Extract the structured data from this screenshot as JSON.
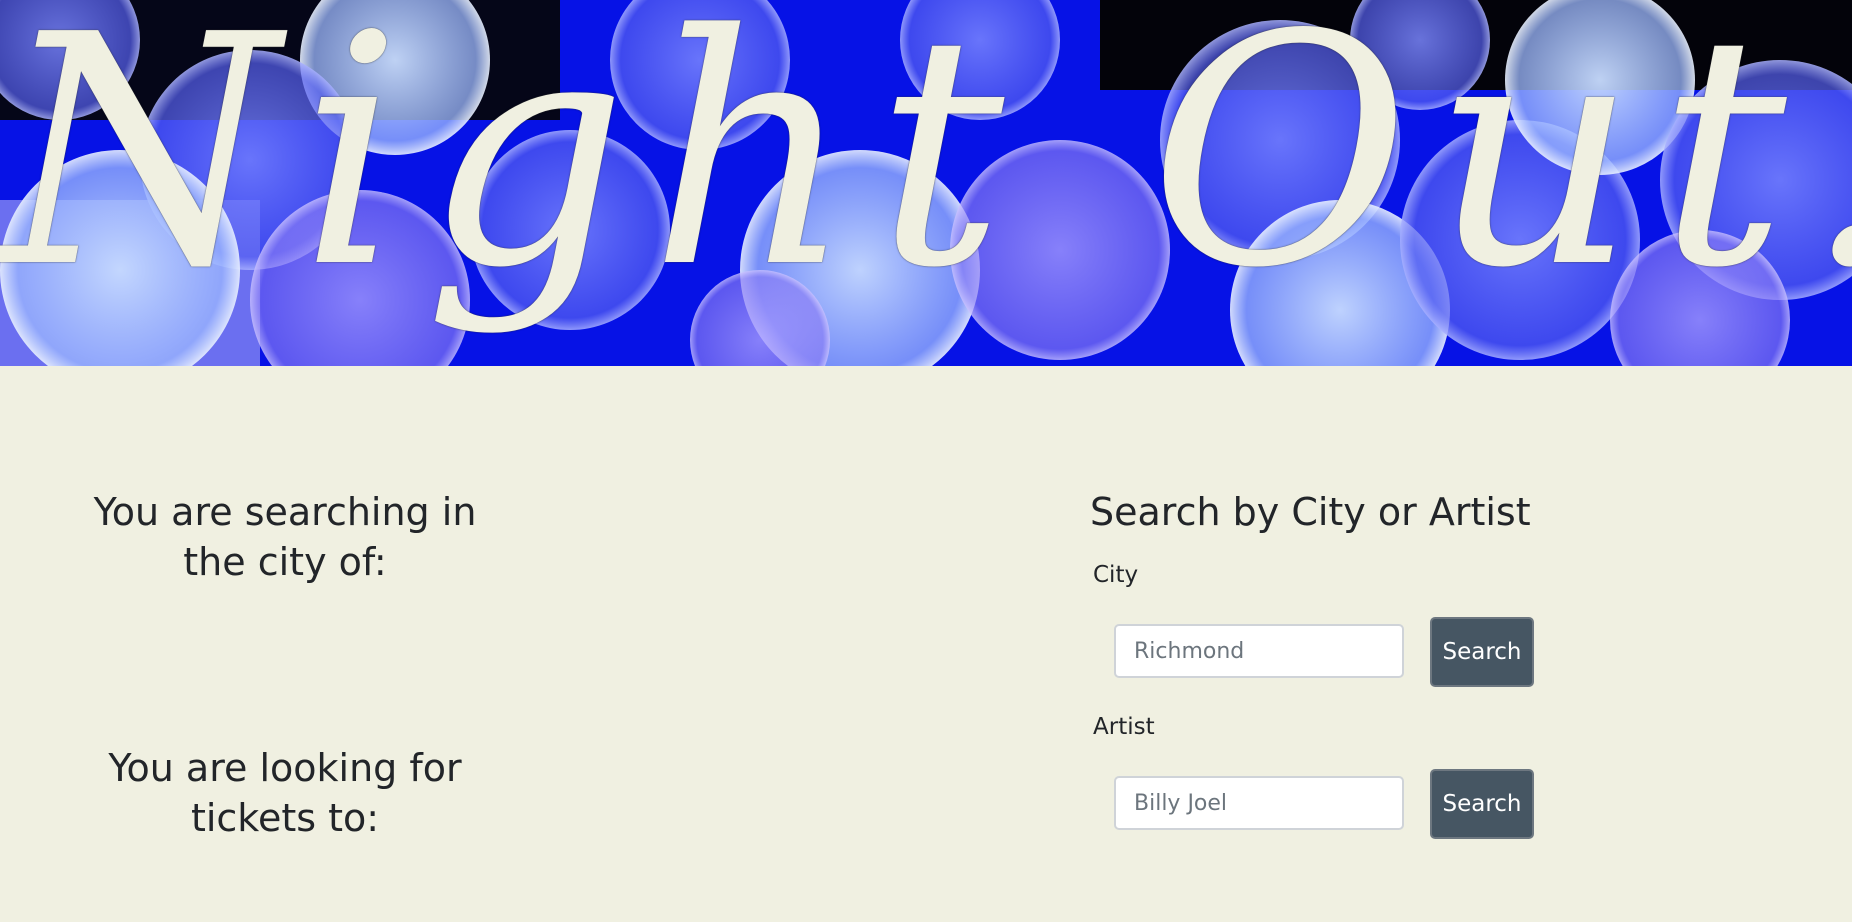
{
  "hero": {
    "title": "Night Out!"
  },
  "left": {
    "city_heading": "You are searching in the city of:",
    "artist_heading": "You are looking for tickets to:"
  },
  "search": {
    "title": "Search by City or Artist",
    "city": {
      "label": "City",
      "placeholder": "Richmond",
      "button_label": "Search"
    },
    "artist": {
      "label": "Artist",
      "placeholder": "Billy Joel",
      "button_label": "Search"
    }
  },
  "colors": {
    "page_background": "#f0f0e1",
    "hero_blue": "#0410e8",
    "title_text": "#f0f0e1",
    "button_background": "#465663",
    "text": "#222529"
  },
  "icons": {
    "hero_background": "bokeh-lights-image"
  }
}
